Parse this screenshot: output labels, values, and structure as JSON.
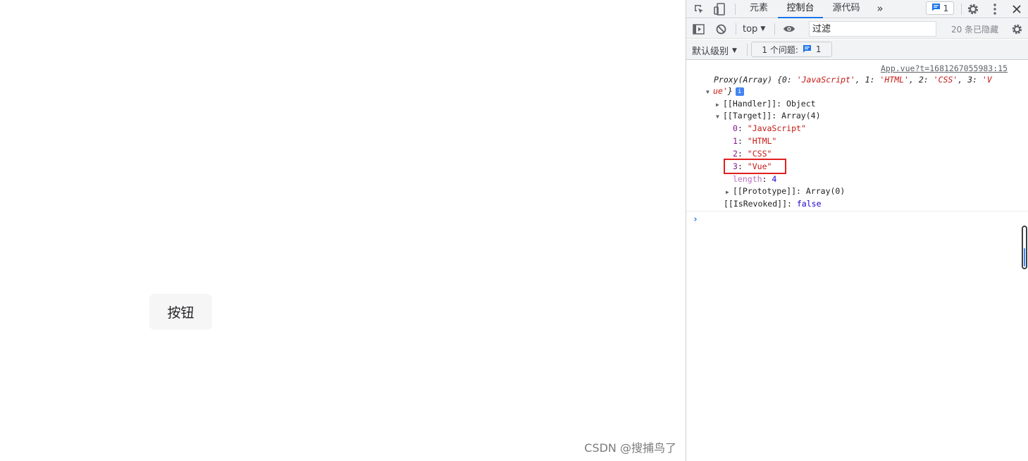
{
  "page": {
    "button_label": "按钮",
    "watermark": "CSDN @搜捕鸟了"
  },
  "devtools": {
    "tabs": [
      {
        "label": "元素",
        "active": false
      },
      {
        "label": "控制台",
        "active": true
      },
      {
        "label": "源代码",
        "active": false
      }
    ],
    "more_tabs": "»",
    "issue_count": "1",
    "toolbar": {
      "context": "top",
      "context_arrow": "▼",
      "filter_placeholder": "过滤",
      "hidden_count": "20 条已隐藏"
    },
    "toolbar2": {
      "level": "默认级别",
      "level_arrow": "▼",
      "issues_label": "1 个问题:",
      "issues_count": "1"
    },
    "console": {
      "source_link": "App.vue?t=1681267055983:15",
      "proxy_summary_1": "Proxy(Array) {0: ",
      "v0": "'JavaScript'",
      "sep1": ", 1: ",
      "v1": "'HTML'",
      "sep2": ", 2: ",
      "v2": "'CSS'",
      "sep3": ", 3: ",
      "v3a": "'V",
      "v3b": "ue'",
      "proxy_close": "}",
      "info_badge": "i",
      "handler_key": "[[Handler]]",
      "handler_val": "Object",
      "target_key": "[[Target]]",
      "target_val": "Array(4)",
      "items": [
        {
          "key": "0",
          "value": "\"JavaScript\""
        },
        {
          "key": "1",
          "value": "\"HTML\""
        },
        {
          "key": "2",
          "value": "\"CSS\""
        },
        {
          "key": "3",
          "value": "\"Vue\""
        }
      ],
      "length_key": "length",
      "length_val": "4",
      "prototype_key": "[[Prototype]]",
      "prototype_val": "Array(0)",
      "revoked_key": "[[IsRevoked]]",
      "revoked_val": "false",
      "prompt": "›"
    }
  },
  "colors": {
    "accent": "#1a73e8",
    "highlight_box": "#e02020",
    "string": "#c41a16",
    "keyword": "#881391"
  }
}
